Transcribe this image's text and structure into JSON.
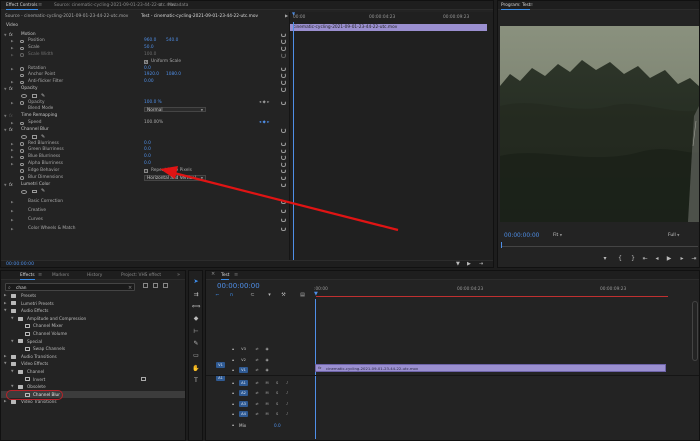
{
  "effect_controls": {
    "tabs": [
      "Effect Controls",
      "Source: cinematic-cycling-2021-09-01-23-44-22-utc.mov",
      "Metadata"
    ],
    "source_line": "Source - cinematic-cycling-2021-09-01-23-44-22-utc.mov",
    "sequence_line": "Test - cinematic-cycling-2021-09-01-23-44-22-utc.mov",
    "section": "Video",
    "motion": {
      "name": "Motion",
      "position_label": "Position",
      "position_x": "960.0",
      "position_y": "540.0",
      "scale_label": "Scale",
      "scale_value": "50.0",
      "scale_width_label": "Scale Width",
      "scale_width_value": "100.0",
      "uniform_label": "Uniform Scale",
      "rotation_label": "Rotation",
      "rotation_value": "0.0",
      "anchor_label": "Anchor Point",
      "anchor_x": "1920.0",
      "anchor_y": "1080.0",
      "flicker_label": "Anti-flicker Filter",
      "flicker_value": "0.00"
    },
    "opacity": {
      "name": "Opacity",
      "opacity_label": "Opacity",
      "opacity_value": "100.0 %",
      "blend_label": "Blend Mode",
      "blend_value": "Normal"
    },
    "time_remap": {
      "name": "Time Remapping",
      "speed_label": "Speed",
      "speed_value": "100.00%"
    },
    "channel_blur": {
      "name": "Channel Blur",
      "red_label": "Red Blurriness",
      "red_value": "0.0",
      "green_label": "Green Blurriness",
      "green_value": "0.0",
      "blue_label": "Blue Blurriness",
      "blue_value": "0.0",
      "alpha_label": "Alpha Blurriness",
      "alpha_value": "0.0",
      "edge_label": "Edge Behavior",
      "edge_value": "Repeat Edge Pixels",
      "dim_label": "Blur Dimensions",
      "dim_value": "Horizontal and Vertical"
    },
    "lumetri": {
      "name": "Lumetri Color",
      "groups": [
        "Basic Correction",
        "Creative",
        "Curves",
        "Color Wheels & Match"
      ]
    },
    "mini_timeline": {
      "ruler": [
        "00:00",
        "00:00:04:23",
        "00:00:09:23"
      ],
      "clip": "cinematic-cycling-2021-09-01-23-44-22-utc.mov"
    },
    "timecode": "00:00:00:00"
  },
  "program": {
    "title": "Program: Test",
    "timecode": "00:00:00:00",
    "fit": "Fit",
    "full": "Full"
  },
  "effects": {
    "tabs": [
      "Effects",
      "Markers",
      "History",
      "Project: VHS effect"
    ],
    "search_value": "chan",
    "tree": {
      "presets": "Presets",
      "lumetri_presets": "Lumetri Presets",
      "audio_effects": "Audio Effects",
      "amp_comp": "Amplitude and Compression",
      "channel_mixer": "Channel Mixer",
      "channel_volume": "Channel Volume",
      "special": "Special",
      "swap_channels": "Swap Channels",
      "audio_transitions": "Audio Transitions",
      "video_effects": "Video Effects",
      "channel": "Channel",
      "invert": "Invert",
      "obsolete": "Obsolete",
      "channel_blur": "Channel Blur",
      "video_transitions": "Video Transitions"
    }
  },
  "timeline": {
    "tab": "Test",
    "timecode": "00:00:00:00",
    "ruler": [
      ":00:00",
      "00:00:04:23",
      "00:00:09:23"
    ],
    "video_tracks": [
      "V3",
      "V2",
      "V1"
    ],
    "audio_tracks": [
      "A1",
      "A2",
      "A3",
      "A4"
    ],
    "source_v": "V1",
    "source_a": "A1",
    "mix_label": "Mix",
    "mix_value": "0.0",
    "clip": "cinematic-cycling-2021-09-01-23-44-22-utc.mov"
  },
  "tools": [
    "selection-tool",
    "track-select-tool",
    "ripple-edit-tool",
    "razor-tool",
    "slip-tool",
    "pen-tool",
    "rectangle-tool",
    "hand-tool",
    "type-tool"
  ],
  "colors": {
    "accent": "#4f8fe8",
    "annotation": "#e01414",
    "clip": "#9a8fd0",
    "highlight": "#b8232a"
  }
}
